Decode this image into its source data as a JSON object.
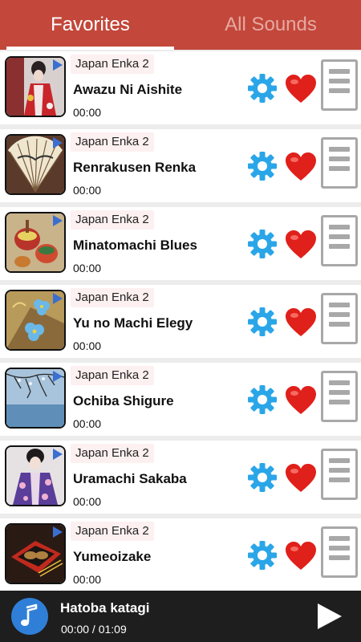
{
  "tabs": [
    {
      "label": "Favorites",
      "active": true
    },
    {
      "label": "All Sounds",
      "active": false
    }
  ],
  "list": [
    {
      "album": "Japan Enka 2",
      "title": "Awazu Ni Aishite",
      "time": "00:00",
      "thumb": "kimono-woman-red"
    },
    {
      "album": "Japan Enka 2",
      "title": "Renrakusen Renka",
      "time": "00:00",
      "thumb": "folding-fan"
    },
    {
      "album": "Japan Enka 2",
      "title": "Minatomachi Blues",
      "time": "00:00",
      "thumb": "spinning-tops"
    },
    {
      "album": "Japan Enka 2",
      "title": "Yu no Machi Elegy",
      "time": "00:00",
      "thumb": "flower-pattern"
    },
    {
      "album": "Japan Enka 2",
      "title": "Ochiba Shigure",
      "time": "00:00",
      "thumb": "winter-tree-lake"
    },
    {
      "album": "Japan Enka 2",
      "title": "Uramachi Sakaba",
      "time": "00:00",
      "thumb": "kimono-woman-purple"
    },
    {
      "album": "Japan Enka 2",
      "title": "Yumeoizake",
      "time": "00:00",
      "thumb": "lacquer-box"
    }
  ],
  "icons": {
    "thumb_play": "play-triangle-icon",
    "settings": "gear-icon",
    "favorite": "heart-icon",
    "lyrics": "document-icon",
    "now_playing": "music-note-icon",
    "play": "play-icon"
  },
  "colors": {
    "tabbar": "#c3473b",
    "gear": "#2aa6e8",
    "heart": "#e0201a",
    "player_bg": "#1e1e1e",
    "music_button": "#2f7fd8"
  },
  "player": {
    "title": "Hatoba katagi",
    "time": "00:00 / 01:09"
  }
}
